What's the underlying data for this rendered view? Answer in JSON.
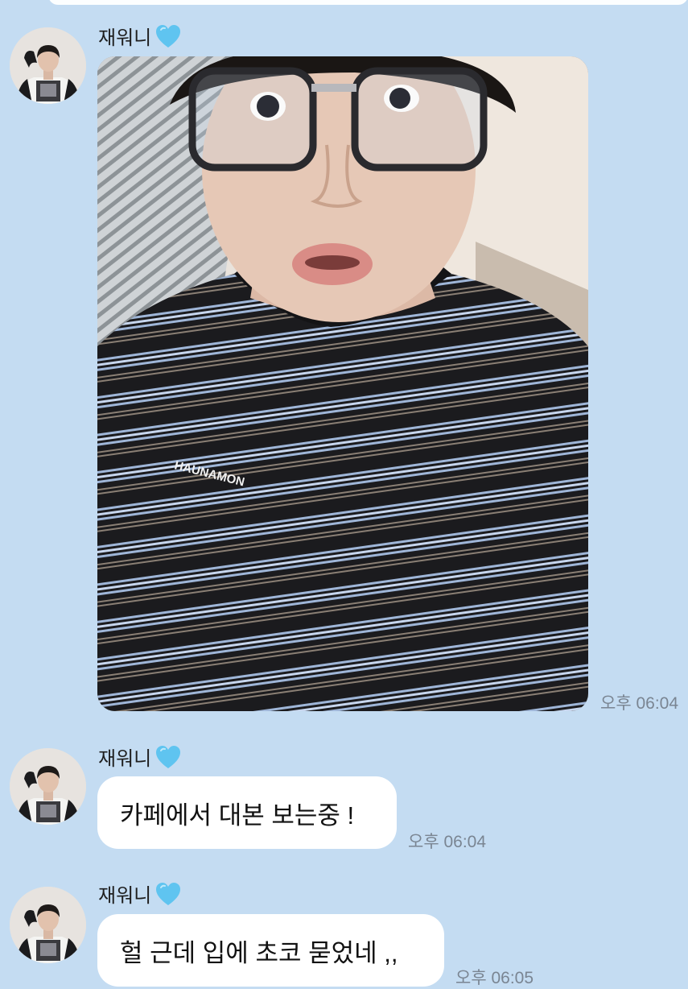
{
  "chat": {
    "messages": [
      {
        "sender": "재워니",
        "sender_badge": "light-blue-heart-icon",
        "type": "photo",
        "photo_shirt_text": "HAUNAMON",
        "time": "오후 06:04"
      },
      {
        "sender": "재워니",
        "sender_badge": "light-blue-heart-icon",
        "type": "text",
        "text": "카페에서 대본 보는중 !",
        "time": "오후 06:04"
      },
      {
        "sender": "재워니",
        "sender_badge": "light-blue-heart-icon",
        "type": "text",
        "text": "헐 근데 입에 초코 묻었네 ,,",
        "time": "오후 06:05"
      }
    ]
  },
  "colors": {
    "background": "#c4dcf2",
    "bubble": "#ffffff",
    "heart": "#5fc4f0",
    "time": "#7a8592"
  }
}
